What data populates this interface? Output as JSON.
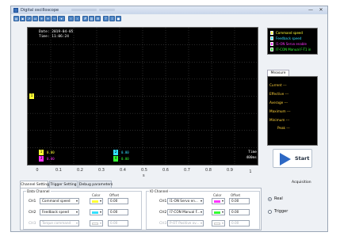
{
  "window": {
    "title": "Digital oscilloscope",
    "controls": {
      "minimize": "—",
      "close": "✕"
    }
  },
  "toolbar": {
    "icons": [
      "open-icon",
      "save-icon",
      "export-icon",
      "print-icon",
      "cursor-icon",
      "zoom-in-icon",
      "zoom-out-icon",
      "fit-icon",
      "back-icon",
      "forward-icon",
      "grid-icon",
      "measure-icon",
      "settings-icon",
      "help-icon",
      "info-icon",
      "record-icon"
    ]
  },
  "scope": {
    "date_label": "Date:",
    "date_value": "2019-04-05",
    "time_label": "Time:",
    "time_value": "11:06:24",
    "channel_marker": "1",
    "background": "#000000",
    "grid_color": "#555555"
  },
  "readouts": [
    {
      "ch": "1",
      "value": "0.00",
      "color": "#ffff33"
    },
    {
      "ch": "2",
      "value": "0.00",
      "color": "#33e0ff"
    },
    {
      "ch": "3",
      "value": "0.00",
      "color": "#ff33ff"
    },
    {
      "ch": "4",
      "value": "0.00",
      "color": "#33ff33"
    }
  ],
  "time_readout": {
    "label": "Time",
    "value": "400ms"
  },
  "x_axis": {
    "ticks": [
      "0",
      "0.1",
      "0.2",
      "0.3",
      "0.4",
      "0.5",
      "0.6",
      "0.7",
      "0.8",
      "0.9",
      "1"
    ],
    "unit": "s"
  },
  "legend": [
    {
      "label": "Command speed",
      "color": "#ffff33"
    },
    {
      "label": "Feedback speed",
      "color": "#33e0ff"
    },
    {
      "label": "I1-ON Servo enable",
      "color": "#ff33ff"
    },
    {
      "label": "I7-CON Manual F-T1 in",
      "color": "#33ff33"
    }
  ],
  "measure": {
    "tab_label": "Measure",
    "rows": [
      "Current ---",
      "Effective ---",
      "Average ---",
      "Maximum ---",
      "Minimum ---",
      "Peak ---"
    ]
  },
  "start_button": {
    "label": "Start"
  },
  "tabs": [
    "Channel Setting",
    "Trigger Setting",
    "Debug parameters"
  ],
  "data_channel": {
    "title": "Data Channel",
    "color_header": "Color",
    "offset_header": "Offset",
    "rows": [
      {
        "ch": "CH1",
        "signal": "Command speed",
        "color": "#ffff33",
        "offset": "0.00",
        "enabled": true
      },
      {
        "ch": "CH2",
        "signal": "Feedback speed",
        "color": "#33e0ff",
        "offset": "0.00",
        "enabled": true
      },
      {
        "ch": "CH3",
        "signal": "Torque command",
        "color": "#ffffff",
        "offset": "0.00",
        "enabled": false
      }
    ]
  },
  "io_channel": {
    "title": "IO Channel",
    "color_header": "Color",
    "offset_header": "Offset",
    "rows": [
      {
        "ch": "CH1",
        "signal": "I1-ON  Servo en...",
        "color": "#ff33ff",
        "offset": "0.00",
        "enabled": true
      },
      {
        "ch": "CH2",
        "signal": "I7-CON Manual F...",
        "color": "#33ff33",
        "offset": "0.00",
        "enabled": true
      },
      {
        "ch": "CH3",
        "signal": "P-OT  Positive ov...",
        "color": "#ffffff",
        "offset": "0.00",
        "enabled": false
      }
    ]
  },
  "acquisition": {
    "title": "Acquisition",
    "options": [
      {
        "label": "Real",
        "selected": true
      },
      {
        "label": "Trigger",
        "selected": false
      }
    ]
  }
}
